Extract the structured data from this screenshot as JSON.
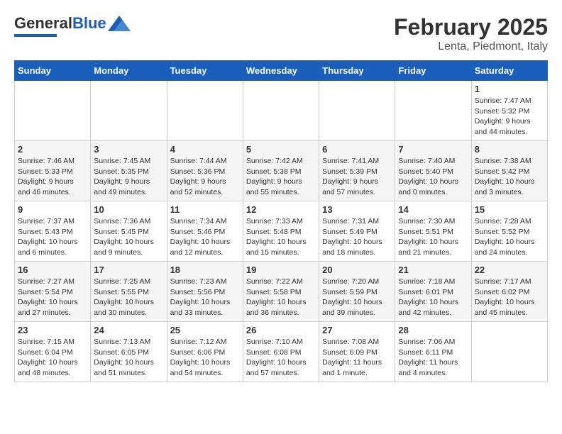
{
  "header": {
    "logo_general": "General",
    "logo_blue": "Blue",
    "title": "February 2025",
    "subtitle": "Lenta, Piedmont, Italy"
  },
  "weekdays": [
    "Sunday",
    "Monday",
    "Tuesday",
    "Wednesday",
    "Thursday",
    "Friday",
    "Saturday"
  ],
  "weeks": [
    [
      {
        "day": "",
        "info": ""
      },
      {
        "day": "",
        "info": ""
      },
      {
        "day": "",
        "info": ""
      },
      {
        "day": "",
        "info": ""
      },
      {
        "day": "",
        "info": ""
      },
      {
        "day": "",
        "info": ""
      },
      {
        "day": "1",
        "info": "Sunrise: 7:47 AM\nSunset: 5:32 PM\nDaylight: 9 hours\nand 44 minutes."
      }
    ],
    [
      {
        "day": "2",
        "info": "Sunrise: 7:46 AM\nSunset: 5:33 PM\nDaylight: 9 hours\nand 46 minutes."
      },
      {
        "day": "3",
        "info": "Sunrise: 7:45 AM\nSunset: 5:35 PM\nDaylight: 9 hours\nand 49 minutes."
      },
      {
        "day": "4",
        "info": "Sunrise: 7:44 AM\nSunset: 5:36 PM\nDaylight: 9 hours\nand 52 minutes."
      },
      {
        "day": "5",
        "info": "Sunrise: 7:42 AM\nSunset: 5:38 PM\nDaylight: 9 hours\nand 55 minutes."
      },
      {
        "day": "6",
        "info": "Sunrise: 7:41 AM\nSunset: 5:39 PM\nDaylight: 9 hours\nand 57 minutes."
      },
      {
        "day": "7",
        "info": "Sunrise: 7:40 AM\nSunset: 5:40 PM\nDaylight: 10 hours\nand 0 minutes."
      },
      {
        "day": "8",
        "info": "Sunrise: 7:38 AM\nSunset: 5:42 PM\nDaylight: 10 hours\nand 3 minutes."
      }
    ],
    [
      {
        "day": "9",
        "info": "Sunrise: 7:37 AM\nSunset: 5:43 PM\nDaylight: 10 hours\nand 6 minutes."
      },
      {
        "day": "10",
        "info": "Sunrise: 7:36 AM\nSunset: 5:45 PM\nDaylight: 10 hours\nand 9 minutes."
      },
      {
        "day": "11",
        "info": "Sunrise: 7:34 AM\nSunset: 5:46 PM\nDaylight: 10 hours\nand 12 minutes."
      },
      {
        "day": "12",
        "info": "Sunrise: 7:33 AM\nSunset: 5:48 PM\nDaylight: 10 hours\nand 15 minutes."
      },
      {
        "day": "13",
        "info": "Sunrise: 7:31 AM\nSunset: 5:49 PM\nDaylight: 10 hours\nand 18 minutes."
      },
      {
        "day": "14",
        "info": "Sunrise: 7:30 AM\nSunset: 5:51 PM\nDaylight: 10 hours\nand 21 minutes."
      },
      {
        "day": "15",
        "info": "Sunrise: 7:28 AM\nSunset: 5:52 PM\nDaylight: 10 hours\nand 24 minutes."
      }
    ],
    [
      {
        "day": "16",
        "info": "Sunrise: 7:27 AM\nSunset: 5:54 PM\nDaylight: 10 hours\nand 27 minutes."
      },
      {
        "day": "17",
        "info": "Sunrise: 7:25 AM\nSunset: 5:55 PM\nDaylight: 10 hours\nand 30 minutes."
      },
      {
        "day": "18",
        "info": "Sunrise: 7:23 AM\nSunset: 5:56 PM\nDaylight: 10 hours\nand 33 minutes."
      },
      {
        "day": "19",
        "info": "Sunrise: 7:22 AM\nSunset: 5:58 PM\nDaylight: 10 hours\nand 36 minutes."
      },
      {
        "day": "20",
        "info": "Sunrise: 7:20 AM\nSunset: 5:59 PM\nDaylight: 10 hours\nand 39 minutes."
      },
      {
        "day": "21",
        "info": "Sunrise: 7:18 AM\nSunset: 6:01 PM\nDaylight: 10 hours\nand 42 minutes."
      },
      {
        "day": "22",
        "info": "Sunrise: 7:17 AM\nSunset: 6:02 PM\nDaylight: 10 hours\nand 45 minutes."
      }
    ],
    [
      {
        "day": "23",
        "info": "Sunrise: 7:15 AM\nSunset: 6:04 PM\nDaylight: 10 hours\nand 48 minutes."
      },
      {
        "day": "24",
        "info": "Sunrise: 7:13 AM\nSunset: 6:05 PM\nDaylight: 10 hours\nand 51 minutes."
      },
      {
        "day": "25",
        "info": "Sunrise: 7:12 AM\nSunset: 6:06 PM\nDaylight: 10 hours\nand 54 minutes."
      },
      {
        "day": "26",
        "info": "Sunrise: 7:10 AM\nSunset: 6:08 PM\nDaylight: 10 hours\nand 57 minutes."
      },
      {
        "day": "27",
        "info": "Sunrise: 7:08 AM\nSunset: 6:09 PM\nDaylight: 11 hours\nand 1 minute."
      },
      {
        "day": "28",
        "info": "Sunrise: 7:06 AM\nSunset: 6:11 PM\nDaylight: 11 hours\nand 4 minutes."
      },
      {
        "day": "",
        "info": ""
      }
    ]
  ]
}
